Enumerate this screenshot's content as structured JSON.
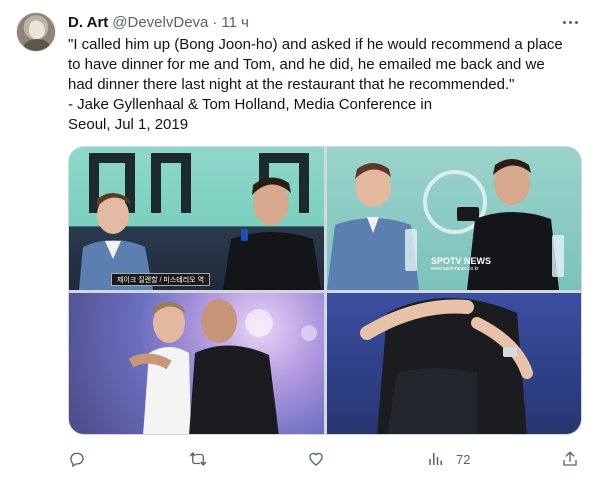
{
  "author": {
    "name": "D. Art",
    "handle": "@DevelvDeva",
    "separator": "·",
    "time": "11 ч"
  },
  "tweet": {
    "lines": [
      "\"I called him up (Bong Joon-ho) and asked if he would recommend a place",
      "to have dinner for me and Tom, and he did, he emailed me back and we",
      "had dinner there last night at the restaurant that he recommended.\"",
      "- Jake Gyllenhaal & Tom Holland, Media Conference in",
      "Seoul, Jul 1, 2019"
    ]
  },
  "media": {
    "photo1_caption": "제이크 질렌할 / 미스테리오 역",
    "photo2_watermark": "SPOTV NEWS",
    "photo2_watermark_sub": "www.spotvnews.co.kr"
  },
  "actions": {
    "reply_icon": "reply-icon",
    "retweet_icon": "retweet-icon",
    "like_icon": "heart-icon",
    "views_icon": "views-icon",
    "views_count": "72",
    "share_icon": "share-icon"
  },
  "colors": {
    "text": "#0f1419",
    "secondary": "#536471",
    "border": "#cfd9de"
  }
}
